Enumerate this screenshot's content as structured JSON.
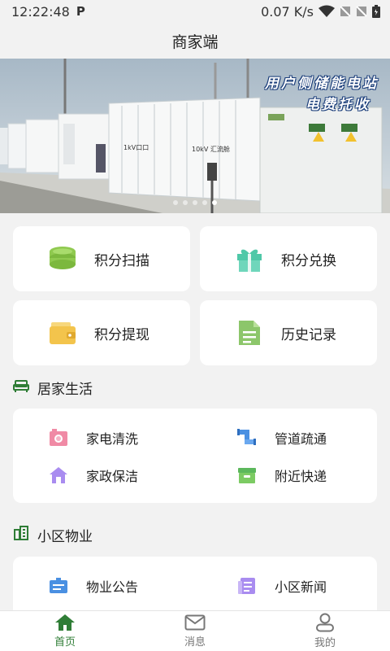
{
  "status": {
    "time": "12:22:48",
    "p_icon": "P",
    "speed": "0.07 K/s"
  },
  "header": {
    "title": "商家端"
  },
  "banner": {
    "line1": "用户侧储能电站",
    "line2": "电费托收",
    "label_a": "1kV口口",
    "label_b": "10kV 汇流舱"
  },
  "grid": [
    {
      "label": "积分扫描",
      "icon": "coin-stack-icon"
    },
    {
      "label": "积分兑换",
      "icon": "gift-icon"
    },
    {
      "label": "积分提现",
      "icon": "wallet-icon"
    },
    {
      "label": "历史记录",
      "icon": "document-icon"
    }
  ],
  "sections": {
    "home_life": {
      "title": "居家生活",
      "items": [
        {
          "label": "家电清洗",
          "icon": "appliance-icon"
        },
        {
          "label": "管道疏通",
          "icon": "pipe-icon"
        },
        {
          "label": "家政保洁",
          "icon": "house-icon"
        },
        {
          "label": "附近快递",
          "icon": "parcel-icon"
        }
      ]
    },
    "property": {
      "title": "小区物业",
      "items": [
        {
          "label": "物业公告",
          "icon": "notice-icon"
        },
        {
          "label": "小区新闻",
          "icon": "news-icon"
        }
      ]
    }
  },
  "tabs": [
    {
      "label": "首页",
      "icon": "home-icon",
      "active": true
    },
    {
      "label": "消息",
      "icon": "mail-icon",
      "active": false
    },
    {
      "label": "我的",
      "icon": "user-icon",
      "active": false
    }
  ],
  "colors": {
    "brand_green": "#2f7d36",
    "coin_green": "#8fc94f",
    "gift_teal": "#4fc8a8",
    "wallet_yellow": "#f3c44c",
    "doc_green": "#8cc66a",
    "pink": "#f08aa5",
    "blue": "#4a90e2",
    "purple": "#a98cf0"
  }
}
